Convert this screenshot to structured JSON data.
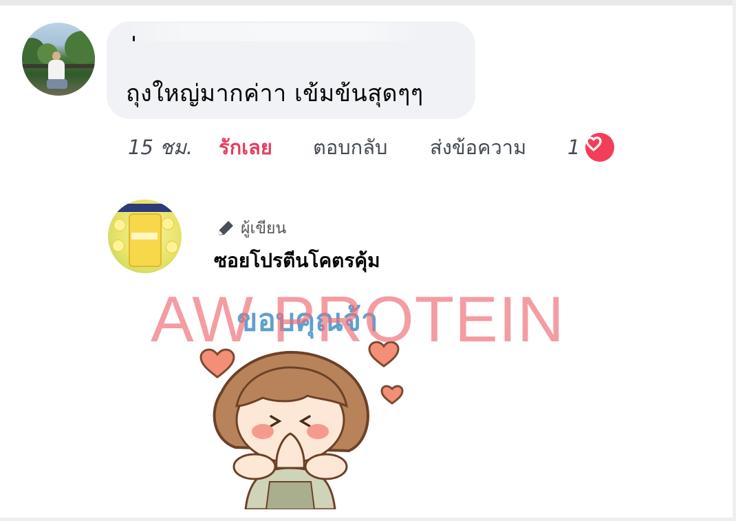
{
  "comment": {
    "text": "ถุงใหญ่มากค่าา  เข้มข้นสุดๆๆ",
    "time": "15 ชม.",
    "actions": {
      "love": "รักเลย",
      "reply": "ตอบกลับ",
      "message": "ส่งข้อความ"
    },
    "reaction_count": "1",
    "reaction_icon": "heart-icon"
  },
  "reply": {
    "author_badge_icon": "pencil-icon",
    "author_label": "ผู้เขียน",
    "page_name": "ซอยโปรตีนโคตรคุ้ม",
    "sticker_text": "ขอบคุณจ้า"
  },
  "watermark": "AW PROTEIN",
  "colors": {
    "accent_red": "#e4405f",
    "heart_bg": "#f33e58",
    "bubble_bg": "#f0f2f5",
    "meta_text": "#444a52"
  }
}
